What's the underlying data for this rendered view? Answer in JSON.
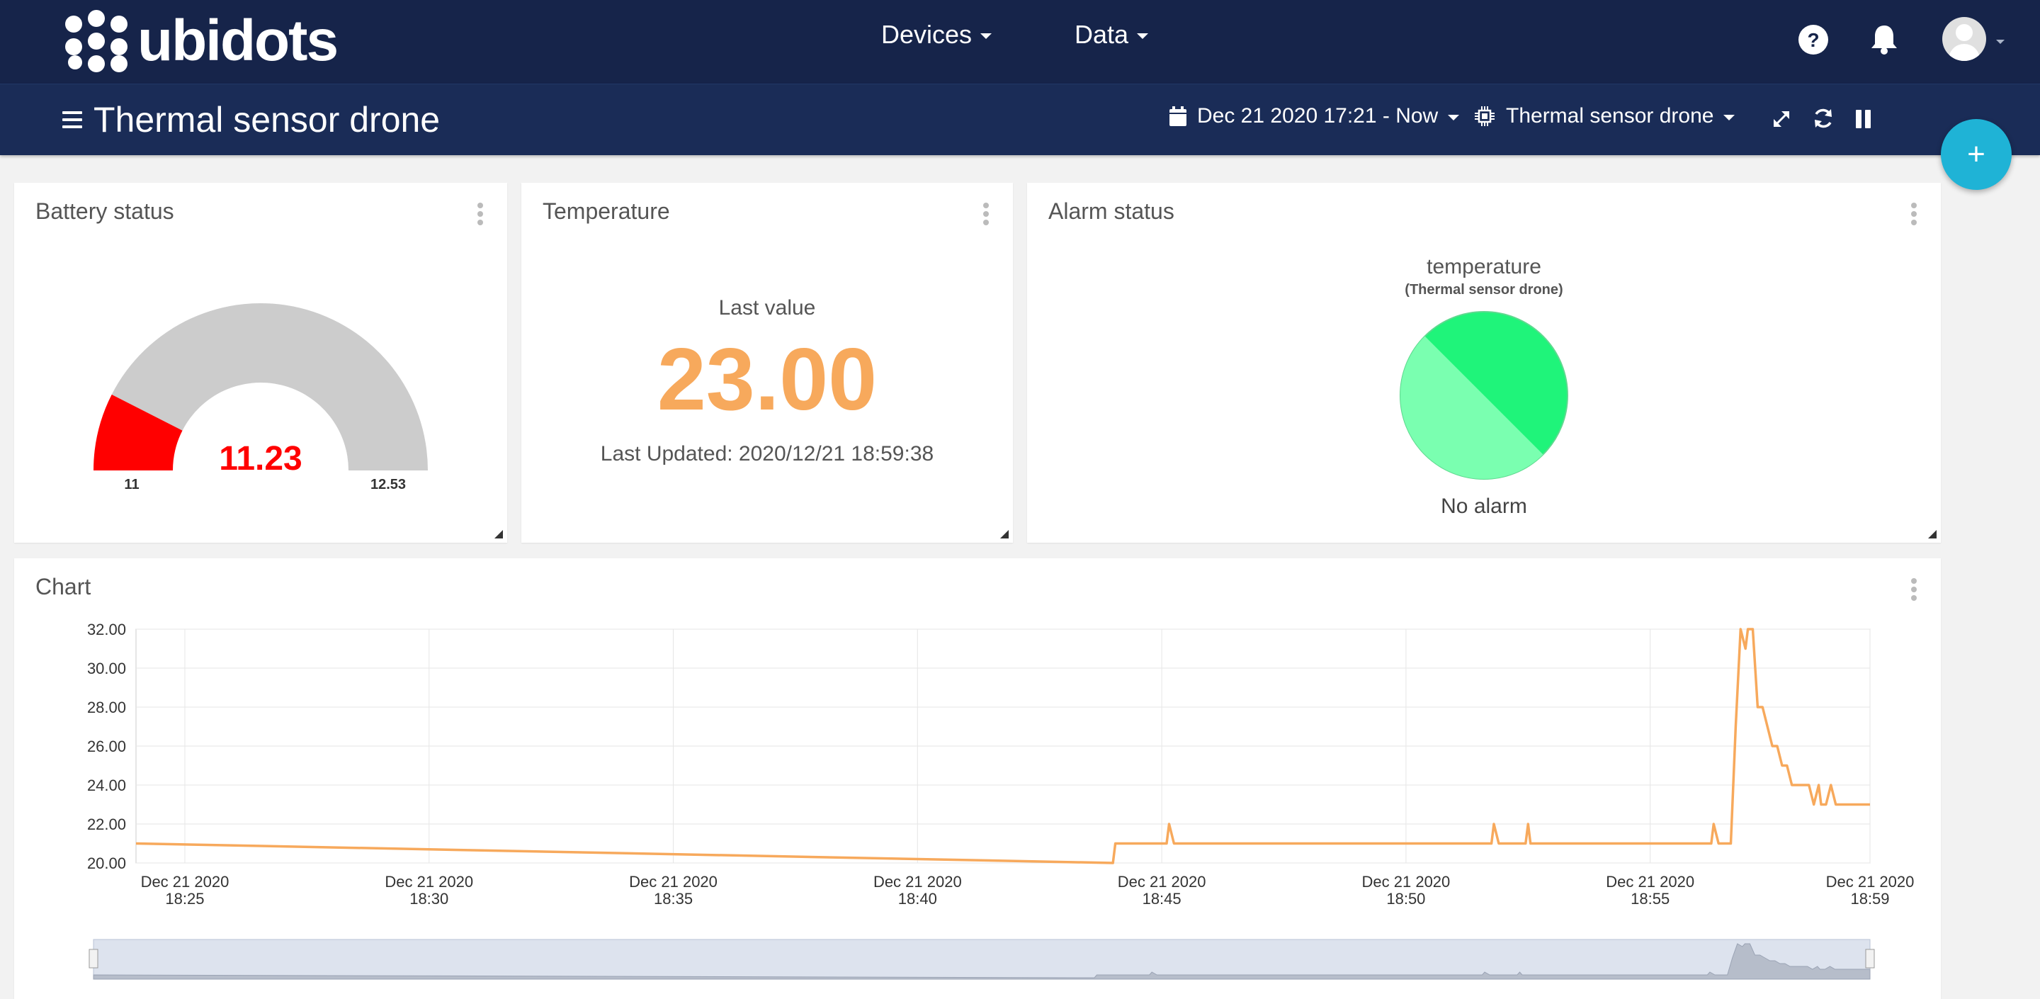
{
  "app": {
    "logo_text": "ubidots"
  },
  "nav": {
    "devices_label": "Devices",
    "data_label": "Data"
  },
  "dashboard": {
    "title": "Thermal sensor drone",
    "date_range": "Dec 21 2020 17:21 - Now",
    "device_filter": "Thermal sensor drone"
  },
  "battery": {
    "title": "Battery status",
    "value": "11.23",
    "min": "11",
    "max": "12.53",
    "fill_fraction": 0.15,
    "fill_color": "#ff0000",
    "track_color": "#cccccc"
  },
  "temperature": {
    "title": "Temperature",
    "subtitle": "Last value",
    "value": "23.00",
    "updated": "Last Updated: 2020/12/21 18:59:38",
    "value_color": "#f7a95c"
  },
  "alarm": {
    "title": "Alarm status",
    "variable": "temperature",
    "device": "(Thermal sensor drone)",
    "status": "No alarm",
    "colors": [
      "#1ff47a",
      "#7affb0"
    ]
  },
  "chart": {
    "title": "Chart"
  },
  "chart_data": {
    "type": "line",
    "ylim": [
      20,
      32
    ],
    "yticks": [
      "32.00",
      "30.00",
      "28.00",
      "26.00",
      "24.00",
      "22.00",
      "20.00"
    ],
    "xlim": [
      -2,
      59
    ],
    "xticks": [
      {
        "t": 0,
        "l1": "Dec 21 2020",
        "l2": "18:25"
      },
      {
        "t": 10,
        "l1": "Dec 21 2020",
        "l2": "18:30"
      },
      {
        "t": 20,
        "l1": "Dec 21 2020",
        "l2": "18:35"
      },
      {
        "t": 30,
        "l1": "Dec 21 2020",
        "l2": "18:40"
      },
      {
        "t": 40,
        "l1": "Dec 21 2020",
        "l2": "18:45"
      },
      {
        "t": 50,
        "l1": "Dec 21 2020",
        "l2": "18:50"
      },
      {
        "t": 60,
        "l1": "Dec 21 2020",
        "l2": "18:55"
      },
      {
        "t": 69,
        "l1": "Dec 21 2020",
        "l2": "18:59"
      }
    ],
    "color": "#f7a95c",
    "series": [
      {
        "points": [
          [
            -2,
            21
          ],
          [
            38,
            20
          ],
          [
            38.1,
            21
          ],
          [
            40.2,
            21
          ],
          [
            40.3,
            22
          ],
          [
            40.5,
            21
          ],
          [
            53.5,
            21
          ],
          [
            53.6,
            22
          ],
          [
            53.8,
            21
          ],
          [
            54.9,
            21
          ],
          [
            55,
            22
          ],
          [
            55.1,
            21
          ],
          [
            62.5,
            21
          ],
          [
            62.6,
            22
          ],
          [
            62.8,
            21
          ],
          [
            63.3,
            21
          ],
          [
            63.5,
            27
          ],
          [
            63.7,
            32
          ],
          [
            63.9,
            31
          ],
          [
            64,
            32
          ],
          [
            64.2,
            32
          ],
          [
            64.4,
            28
          ],
          [
            64.6,
            28
          ],
          [
            64.8,
            27
          ],
          [
            65,
            26
          ],
          [
            65.2,
            26
          ],
          [
            65.4,
            25
          ],
          [
            65.6,
            25
          ],
          [
            65.8,
            24
          ],
          [
            66.5,
            24
          ],
          [
            66.7,
            23
          ],
          [
            66.9,
            24
          ],
          [
            67,
            23
          ],
          [
            67.2,
            23
          ],
          [
            67.4,
            24
          ],
          [
            67.6,
            23
          ],
          [
            69,
            23
          ]
        ]
      }
    ]
  }
}
